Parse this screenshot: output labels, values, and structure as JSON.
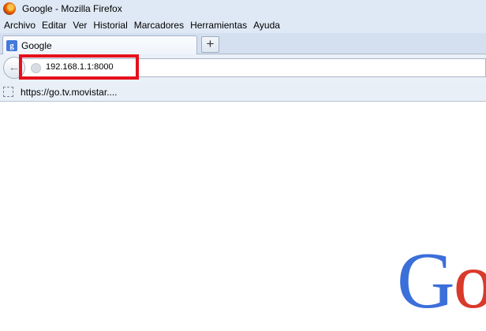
{
  "window": {
    "title": "Google - Mozilla Firefox"
  },
  "menu": {
    "items": [
      "Archivo",
      "Editar",
      "Ver",
      "Historial",
      "Marcadores",
      "Herramientas",
      "Ayuda"
    ]
  },
  "tabs": [
    {
      "label": "Google",
      "icon": "google-favicon"
    }
  ],
  "newtab": {
    "label": "+"
  },
  "urlbar": {
    "value": "192.168.1.1:8000"
  },
  "bookmarks": [
    {
      "label": "https://go.tv.movistar...."
    }
  ],
  "logo": {
    "part1": "G",
    "part2": "o"
  },
  "colors": {
    "highlight": "#e5101b",
    "google_blue": "#3b6fd9",
    "google_red": "#d93a2b"
  }
}
